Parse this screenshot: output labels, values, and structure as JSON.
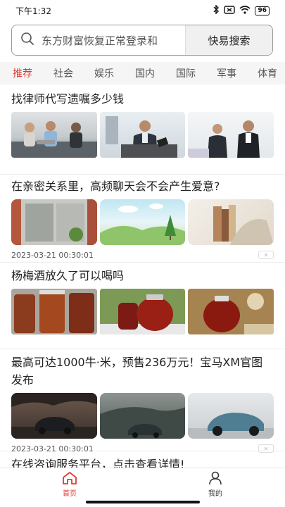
{
  "status_bar": {
    "time": "下午1:32",
    "battery": "96"
  },
  "search": {
    "query": "东方财富恢复正常登录和",
    "button_label": "快易搜索"
  },
  "tabs": [
    {
      "label": "推荐",
      "active": true
    },
    {
      "label": "社会"
    },
    {
      "label": "娱乐"
    },
    {
      "label": "国内"
    },
    {
      "label": "国际"
    },
    {
      "label": "军事"
    },
    {
      "label": "体育"
    }
  ],
  "articles": [
    {
      "title": "找律师代写遗嘱多少钱",
      "date": ""
    },
    {
      "title": "在亲密关系里，高频聊天会不会产生爱意?",
      "date": "2023-03-21 00:30:01"
    },
    {
      "title": "杨梅酒放久了可以喝吗",
      "date": ""
    },
    {
      "title": "最高可达1000牛·米，预售236万元！宝马XM官图发布",
      "date": "2023-03-21 00:30:01"
    },
    {
      "title": "在线咨询服务平台，点击查看详情!",
      "date": ""
    }
  ],
  "bottom_nav": {
    "home_label": "首页",
    "profile_label": "我的"
  },
  "colors": {
    "accent": "#e03b30"
  }
}
